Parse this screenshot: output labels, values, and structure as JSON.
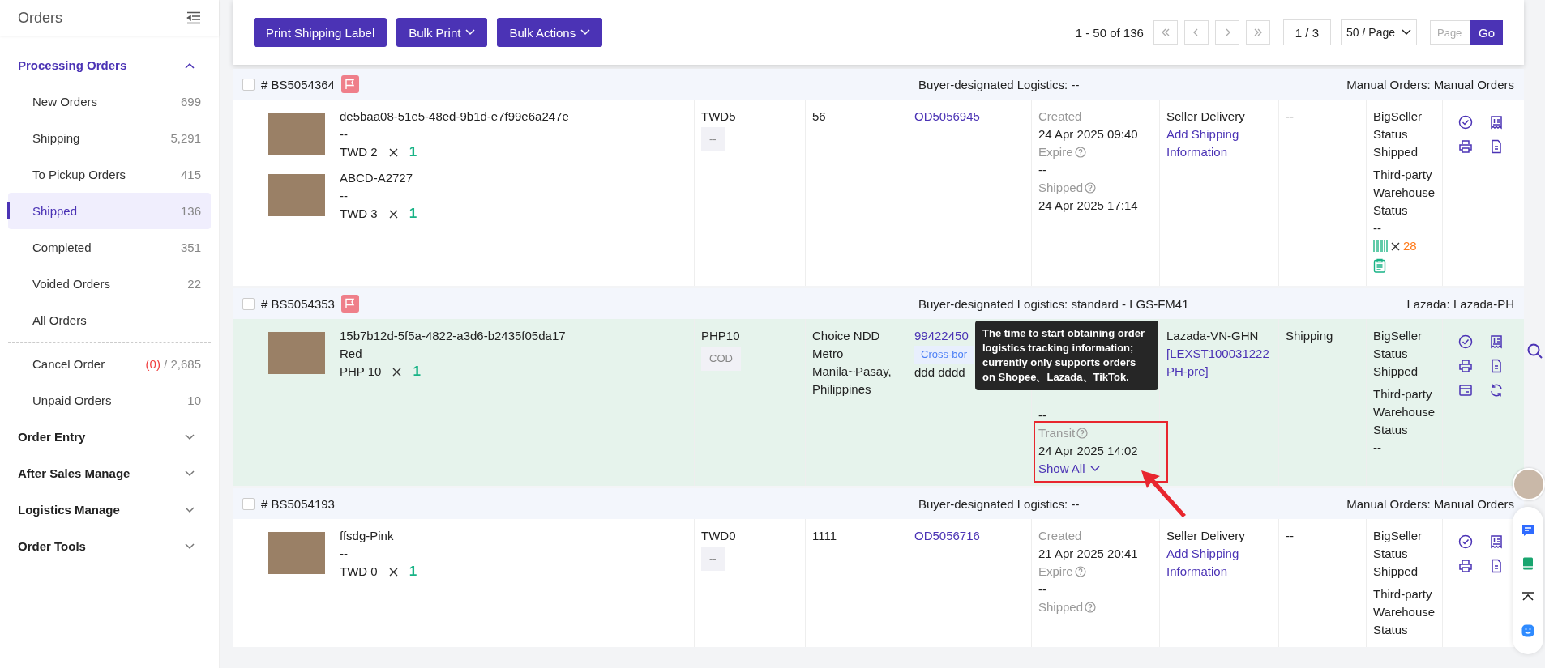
{
  "sidebar": {
    "title": "Orders",
    "groups": [
      {
        "label": "Processing Orders",
        "expanded": true,
        "items": [
          {
            "label": "New Orders",
            "count": "699",
            "selected": false
          },
          {
            "label": "Shipping",
            "count": "5,291",
            "selected": false
          },
          {
            "label": "To Pickup Orders",
            "count": "415",
            "selected": false
          },
          {
            "label": "Shipped",
            "count": "136",
            "selected": true
          },
          {
            "label": "Completed",
            "count": "351",
            "selected": false
          },
          {
            "label": "Voided Orders",
            "count": "22",
            "selected": false
          },
          {
            "label": "All Orders",
            "selected": false
          }
        ],
        "more_items": [
          {
            "label": "Cancel Order",
            "alert": "(0)",
            "count": "/ 2,685",
            "selected": false
          },
          {
            "label": "Unpaid Orders",
            "count": "10",
            "selected": false
          }
        ]
      },
      {
        "label": "Order Entry",
        "expanded": false
      },
      {
        "label": "After Sales Manage",
        "expanded": false
      },
      {
        "label": "Logistics Manage",
        "expanded": false
      },
      {
        "label": "Order Tools",
        "expanded": false
      }
    ]
  },
  "toolbar": {
    "buttons": [
      {
        "label": "Print Shipping Label",
        "dropdown": false
      },
      {
        "label": "Bulk Print",
        "dropdown": true
      },
      {
        "label": "Bulk Actions",
        "dropdown": true
      }
    ],
    "pagination": {
      "summary": "1 - 50 of 136",
      "page": "1 / 3",
      "page_size": "50 / Page",
      "jump_placeholder": "Page",
      "go": "Go"
    }
  },
  "orders": [
    {
      "number": "# BS5054364",
      "checked": false,
      "flagged": true,
      "hovered": false,
      "highlighted": false,
      "logistics": "Buyer-designated Logistics: --",
      "source": "Manual Orders: Manual Orders",
      "products": [
        {
          "name": "de5baa08-51e5-48ed-9b1d-e7f99e6a247e",
          "variant": "--",
          "price": "TWD 2",
          "quantity": "1"
        },
        {
          "name": "ABCD-A2727",
          "variant": "--",
          "price": "TWD 3",
          "quantity": "1"
        }
      ],
      "amount": "TWD5",
      "payment": "--",
      "address": "56",
      "order_link": "OD5056945",
      "times": [
        {
          "label": "Created",
          "help": false,
          "value": "24 Apr 2025 09:40"
        },
        {
          "label": "Expire",
          "help": true,
          "value": "--"
        },
        {
          "label": "Shipped",
          "help": true,
          "value": "24 Apr 2025 17:14"
        }
      ],
      "shipping_method": "Seller Delivery",
      "shipping_link": "Add Shipping Information",
      "tracking": "--",
      "status": "BigSeller Status Shipped",
      "warehouse_status": "Third-party Warehouse Status",
      "warehouse_value": "--",
      "barcode_count": "28",
      "picklist": true,
      "actions": [
        {
          "kind": "check"
        },
        {
          "kind": "receipt"
        },
        {
          "kind": "print"
        },
        {
          "kind": "document"
        }
      ]
    },
    {
      "number": "# BS5054353",
      "checked": false,
      "flagged": true,
      "hovered": true,
      "highlighted": true,
      "logistics": "Buyer-designated Logistics: standard - LGS-FM41",
      "source": "Lazada: Lazada-PH",
      "products": [
        {
          "name": "15b7b12d-5f5a-4822-a3d6-b2435f05da17",
          "variant": "Red",
          "price": "PHP 10",
          "quantity": "1"
        }
      ],
      "amount": "PHP10",
      "payment": "COD",
      "address": "Choice NDD Metro Manila~Pasay, Philippines",
      "order_link": "99422450",
      "order_tag": "Cross-bor",
      "order_note": "ddd dddd",
      "times": [
        {
          "value": "--"
        },
        {
          "label": "Transit",
          "help": true,
          "value": "24 Apr 2025 14:02"
        }
      ],
      "show_all": "Show All",
      "tooltip": "The time to start obtaining order logistics tracking information; currently only supports orders on Shopee、Lazada、TikTok.",
      "shipping_method": "Lazada-VN-GHN",
      "shipping_link": "[LEXST100031222 PH-pre]",
      "tracking": "Shipping",
      "status": "BigSeller Status Shipped",
      "warehouse_status": "Third-party Warehouse Status",
      "warehouse_value": "--",
      "picklist": false,
      "actions": [
        {
          "kind": "check"
        },
        {
          "kind": "receipt"
        },
        {
          "kind": "print"
        },
        {
          "kind": "document"
        },
        {
          "kind": "card"
        },
        {
          "kind": "refresh"
        }
      ]
    },
    {
      "number": "# BS5054193",
      "checked": false,
      "flagged": false,
      "hovered": false,
      "highlighted": false,
      "logistics": "Buyer-designated Logistics: --",
      "source": "Manual Orders: Manual Orders",
      "products": [
        {
          "name": "ffsdg-Pink",
          "variant": "--",
          "price": "TWD 0",
          "quantity": "1"
        }
      ],
      "amount": "TWD0",
      "payment": "--",
      "address": "1111",
      "order_link": "OD5056716",
      "times": [
        {
          "label": "Created",
          "help": false,
          "value": "21 Apr 2025 20:41"
        },
        {
          "label": "Expire",
          "help": true,
          "value": "--"
        },
        {
          "label": "Shipped",
          "help": true
        }
      ],
      "shipping_method": "Seller Delivery",
      "shipping_link": "Add Shipping Information",
      "tracking": "--",
      "status": "BigSeller Status Shipped",
      "warehouse_status": "Third-party Warehouse Status",
      "picklist": false,
      "actions": [
        {
          "kind": "check"
        },
        {
          "kind": "receipt"
        },
        {
          "kind": "print"
        },
        {
          "kind": "document"
        }
      ]
    }
  ]
}
